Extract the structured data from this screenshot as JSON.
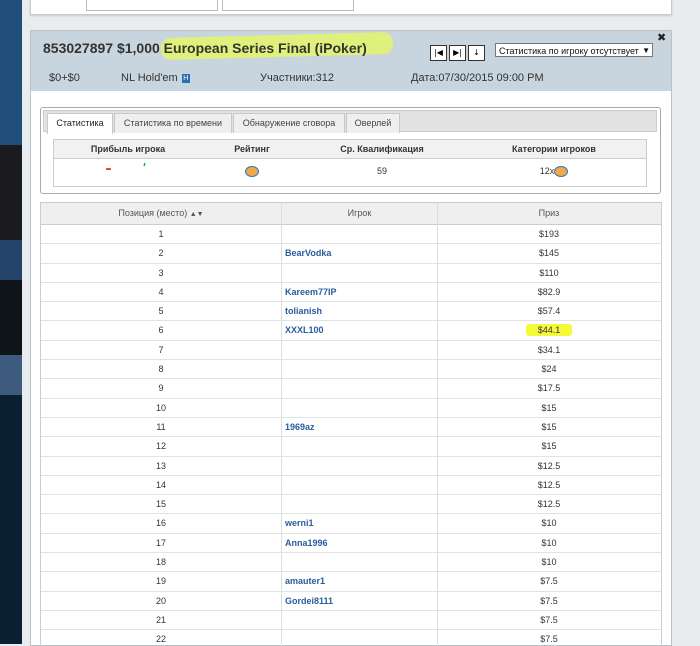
{
  "colors": {
    "header_bg": "#c8d5df",
    "highlight": "#e3f56b",
    "player_link": "#2a5d9b"
  },
  "header": {
    "title": "853027897 $1,000 European Series Final (iPoker)",
    "stats_select": "Статистика по игроку отсутствует",
    "meta": {
      "buyin": "$0+$0",
      "game": "NL Hold'em",
      "game_icon": "H",
      "participants": "Участники:312",
      "date": "Дата:07/30/2015 09:00 PM"
    }
  },
  "nav_buttons": [
    "|◀",
    "▶|",
    "↓"
  ],
  "tabs": [
    {
      "label": "Статистика",
      "active": true
    },
    {
      "label": "Статистика по времени",
      "active": false
    },
    {
      "label": "Обнаружение сговора",
      "active": false
    },
    {
      "label": "Оверлей",
      "active": false
    }
  ],
  "stats": {
    "headers": [
      "Прибыль игрока",
      "Рейтинг",
      "Ср. Квалификация",
      "Категории игроков"
    ],
    "qualification": "59",
    "categories_count": "12x",
    "rating_icon": "fish-icon"
  },
  "results": {
    "headers": {
      "position": "Позиция (место)",
      "player": "Игрок",
      "prize": "Приз"
    },
    "rows": [
      {
        "pos": "1",
        "player": "",
        "prize": "$193"
      },
      {
        "pos": "2",
        "player": "BearVodka",
        "prize": "$145"
      },
      {
        "pos": "3",
        "player": "",
        "prize": "$110"
      },
      {
        "pos": "4",
        "player": "Kareem77IP",
        "prize": "$82.9"
      },
      {
        "pos": "5",
        "player": "tolianish",
        "prize": "$57.4"
      },
      {
        "pos": "6",
        "player": "XXXL100",
        "prize": "$44.1",
        "highlight": true
      },
      {
        "pos": "7",
        "player": "",
        "prize": "$34.1"
      },
      {
        "pos": "8",
        "player": "",
        "prize": "$24"
      },
      {
        "pos": "9",
        "player": "",
        "prize": "$17.5"
      },
      {
        "pos": "10",
        "player": "",
        "prize": "$15"
      },
      {
        "pos": "11",
        "player": "1969az",
        "prize": "$15"
      },
      {
        "pos": "12",
        "player": "",
        "prize": "$15"
      },
      {
        "pos": "13",
        "player": "",
        "prize": "$12.5"
      },
      {
        "pos": "14",
        "player": "",
        "prize": "$12.5"
      },
      {
        "pos": "15",
        "player": "",
        "prize": "$12.5"
      },
      {
        "pos": "16",
        "player": "werni1",
        "prize": "$10"
      },
      {
        "pos": "17",
        "player": "Anna1996",
        "prize": "$10"
      },
      {
        "pos": "18",
        "player": "",
        "prize": "$10"
      },
      {
        "pos": "19",
        "player": "amauter1",
        "prize": "$7.5"
      },
      {
        "pos": "20",
        "player": "Gordei8111",
        "prize": "$7.5"
      },
      {
        "pos": "21",
        "player": "",
        "prize": "$7.5"
      },
      {
        "pos": "22",
        "player": "",
        "prize": "$7.5"
      }
    ]
  }
}
